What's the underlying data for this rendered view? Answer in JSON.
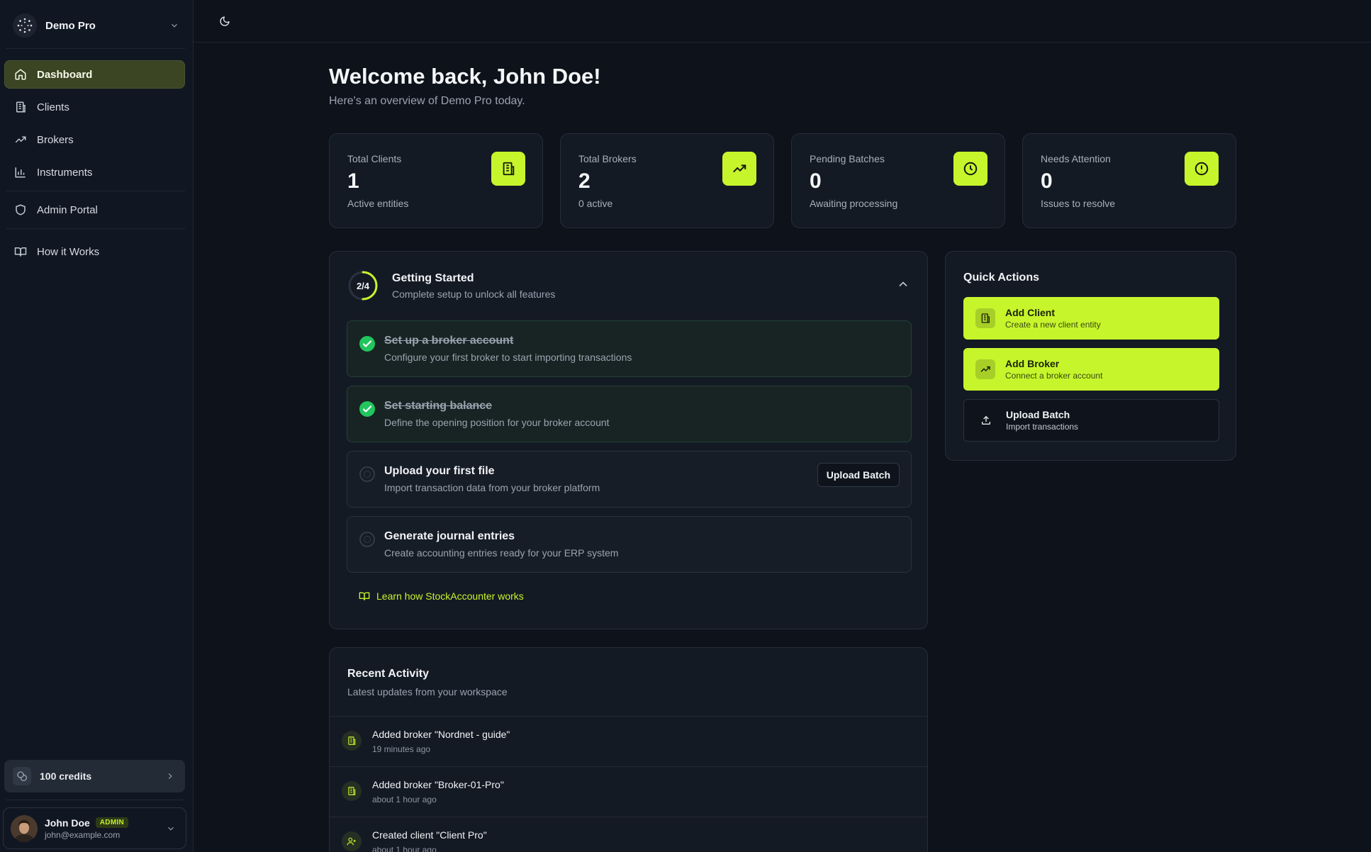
{
  "workspace": {
    "name": "Demo Pro"
  },
  "nav": {
    "items": [
      {
        "label": "Dashboard",
        "icon": "home-icon",
        "active": true
      },
      {
        "label": "Clients",
        "icon": "building-icon"
      },
      {
        "label": "Brokers",
        "icon": "trending-up-icon"
      },
      {
        "label": "Instruments",
        "icon": "bar-chart-icon"
      },
      {
        "label": "Admin Portal",
        "icon": "shield-icon"
      },
      {
        "label": "How it Works",
        "icon": "book-open-icon"
      }
    ]
  },
  "credits": {
    "label": "100 credits"
  },
  "user": {
    "name": "John Doe",
    "role_badge": "ADMIN",
    "email": "john@example.com"
  },
  "header": {
    "title": "Welcome back, John Doe!",
    "subtitle": "Here's an overview of Demo Pro today."
  },
  "stats": [
    {
      "label": "Total Clients",
      "value": "1",
      "sub": "Active entities",
      "icon": "building-icon"
    },
    {
      "label": "Total Brokers",
      "value": "2",
      "sub": "0 active",
      "icon": "trending-up-icon"
    },
    {
      "label": "Pending Batches",
      "value": "0",
      "sub": "Awaiting processing",
      "icon": "clock-icon"
    },
    {
      "label": "Needs Attention",
      "value": "0",
      "sub": "Issues to resolve",
      "icon": "alert-circle-icon"
    }
  ],
  "getting_started": {
    "progress_text": "2/4",
    "progress_fraction": 0.5,
    "title": "Getting Started",
    "subtitle": "Complete setup to unlock all features",
    "steps": [
      {
        "title": "Set up a broker account",
        "description": "Configure your first broker to start importing transactions",
        "done": true
      },
      {
        "title": "Set starting balance",
        "description": "Define the opening position for your broker account",
        "done": true
      },
      {
        "title": "Upload your first file",
        "description": "Import transaction data from your broker platform",
        "done": false,
        "action": "Upload Batch"
      },
      {
        "title": "Generate journal entries",
        "description": "Create accounting entries ready for your ERP system",
        "done": false
      }
    ],
    "learn_link": "Learn how StockAccounter works"
  },
  "quick_actions": {
    "title": "Quick Actions",
    "items": [
      {
        "label": "Add Client",
        "sub": "Create a new client entity",
        "icon": "building-icon",
        "style": "primary"
      },
      {
        "label": "Add Broker",
        "sub": "Connect a broker account",
        "icon": "trending-up-icon",
        "style": "primary"
      },
      {
        "label": "Upload Batch",
        "sub": "Import transactions",
        "icon": "upload-icon",
        "style": "outline"
      }
    ]
  },
  "recent_activity": {
    "title": "Recent Activity",
    "subtitle": "Latest updates from your workspace",
    "items": [
      {
        "text": "Added broker \"Nordnet - guide\"",
        "time": "19 minutes ago",
        "icon": "building-icon"
      },
      {
        "text": "Added broker \"Broker-01-Pro\"",
        "time": "about 1 hour ago",
        "icon": "building-icon"
      },
      {
        "text": "Created client \"Client Pro\"",
        "time": "about 1 hour ago",
        "icon": "user-plus-icon"
      }
    ]
  },
  "colors": {
    "accent": "#c6f52c",
    "success": "#22c55e",
    "background": "#0d121b",
    "surface": "#141a24"
  }
}
